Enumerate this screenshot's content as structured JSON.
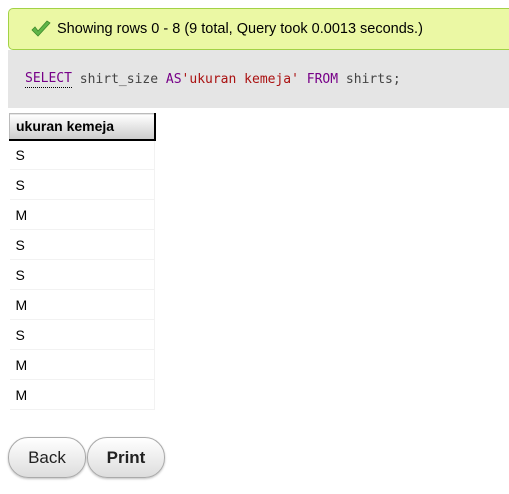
{
  "message": {
    "icon": "check-icon",
    "text": "Showing rows 0 - 8 (9 total, Query took 0.0013 seconds.)",
    "background_color": "#ebf8a4",
    "icon_color": "#5fb548"
  },
  "sql": {
    "select_keyword": "SELECT",
    "part1": " shirt_size ",
    "as_keyword": "AS",
    "alias": "'ukuran kemeja'",
    "space": " ",
    "from_keyword": "FROM",
    "part2": " shirts;"
  },
  "table": {
    "header": "ukuran kemeja",
    "rows": [
      "S",
      "S",
      "M",
      "S",
      "S",
      "M",
      "S",
      "M",
      "M"
    ]
  },
  "buttons": {
    "back_label": "Back",
    "print_label": "Print"
  }
}
